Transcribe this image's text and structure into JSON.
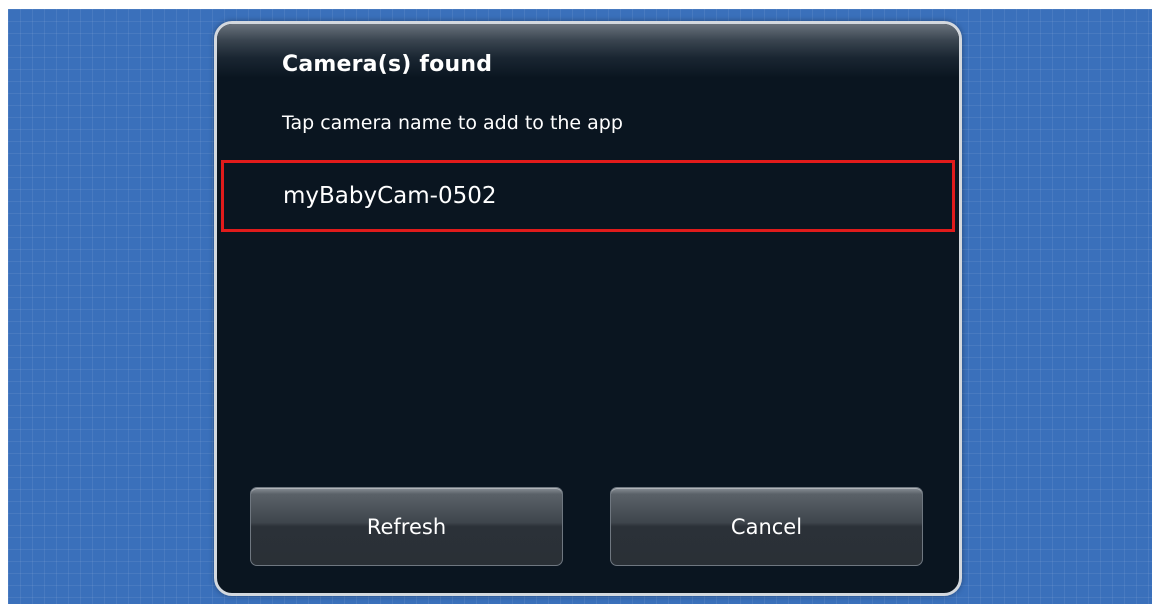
{
  "dialog": {
    "title": "Camera(s) found",
    "subtitle": "Tap camera name to add to the app",
    "cameras": [
      {
        "name": "myBabyCam-0502",
        "highlighted": true
      }
    ],
    "buttons": {
      "refresh_label": "Refresh",
      "cancel_label": "Cancel"
    }
  },
  "colors": {
    "background": "#3a70bb",
    "dialog_background": "#0a1520",
    "highlight_border": "#e01b1b"
  }
}
